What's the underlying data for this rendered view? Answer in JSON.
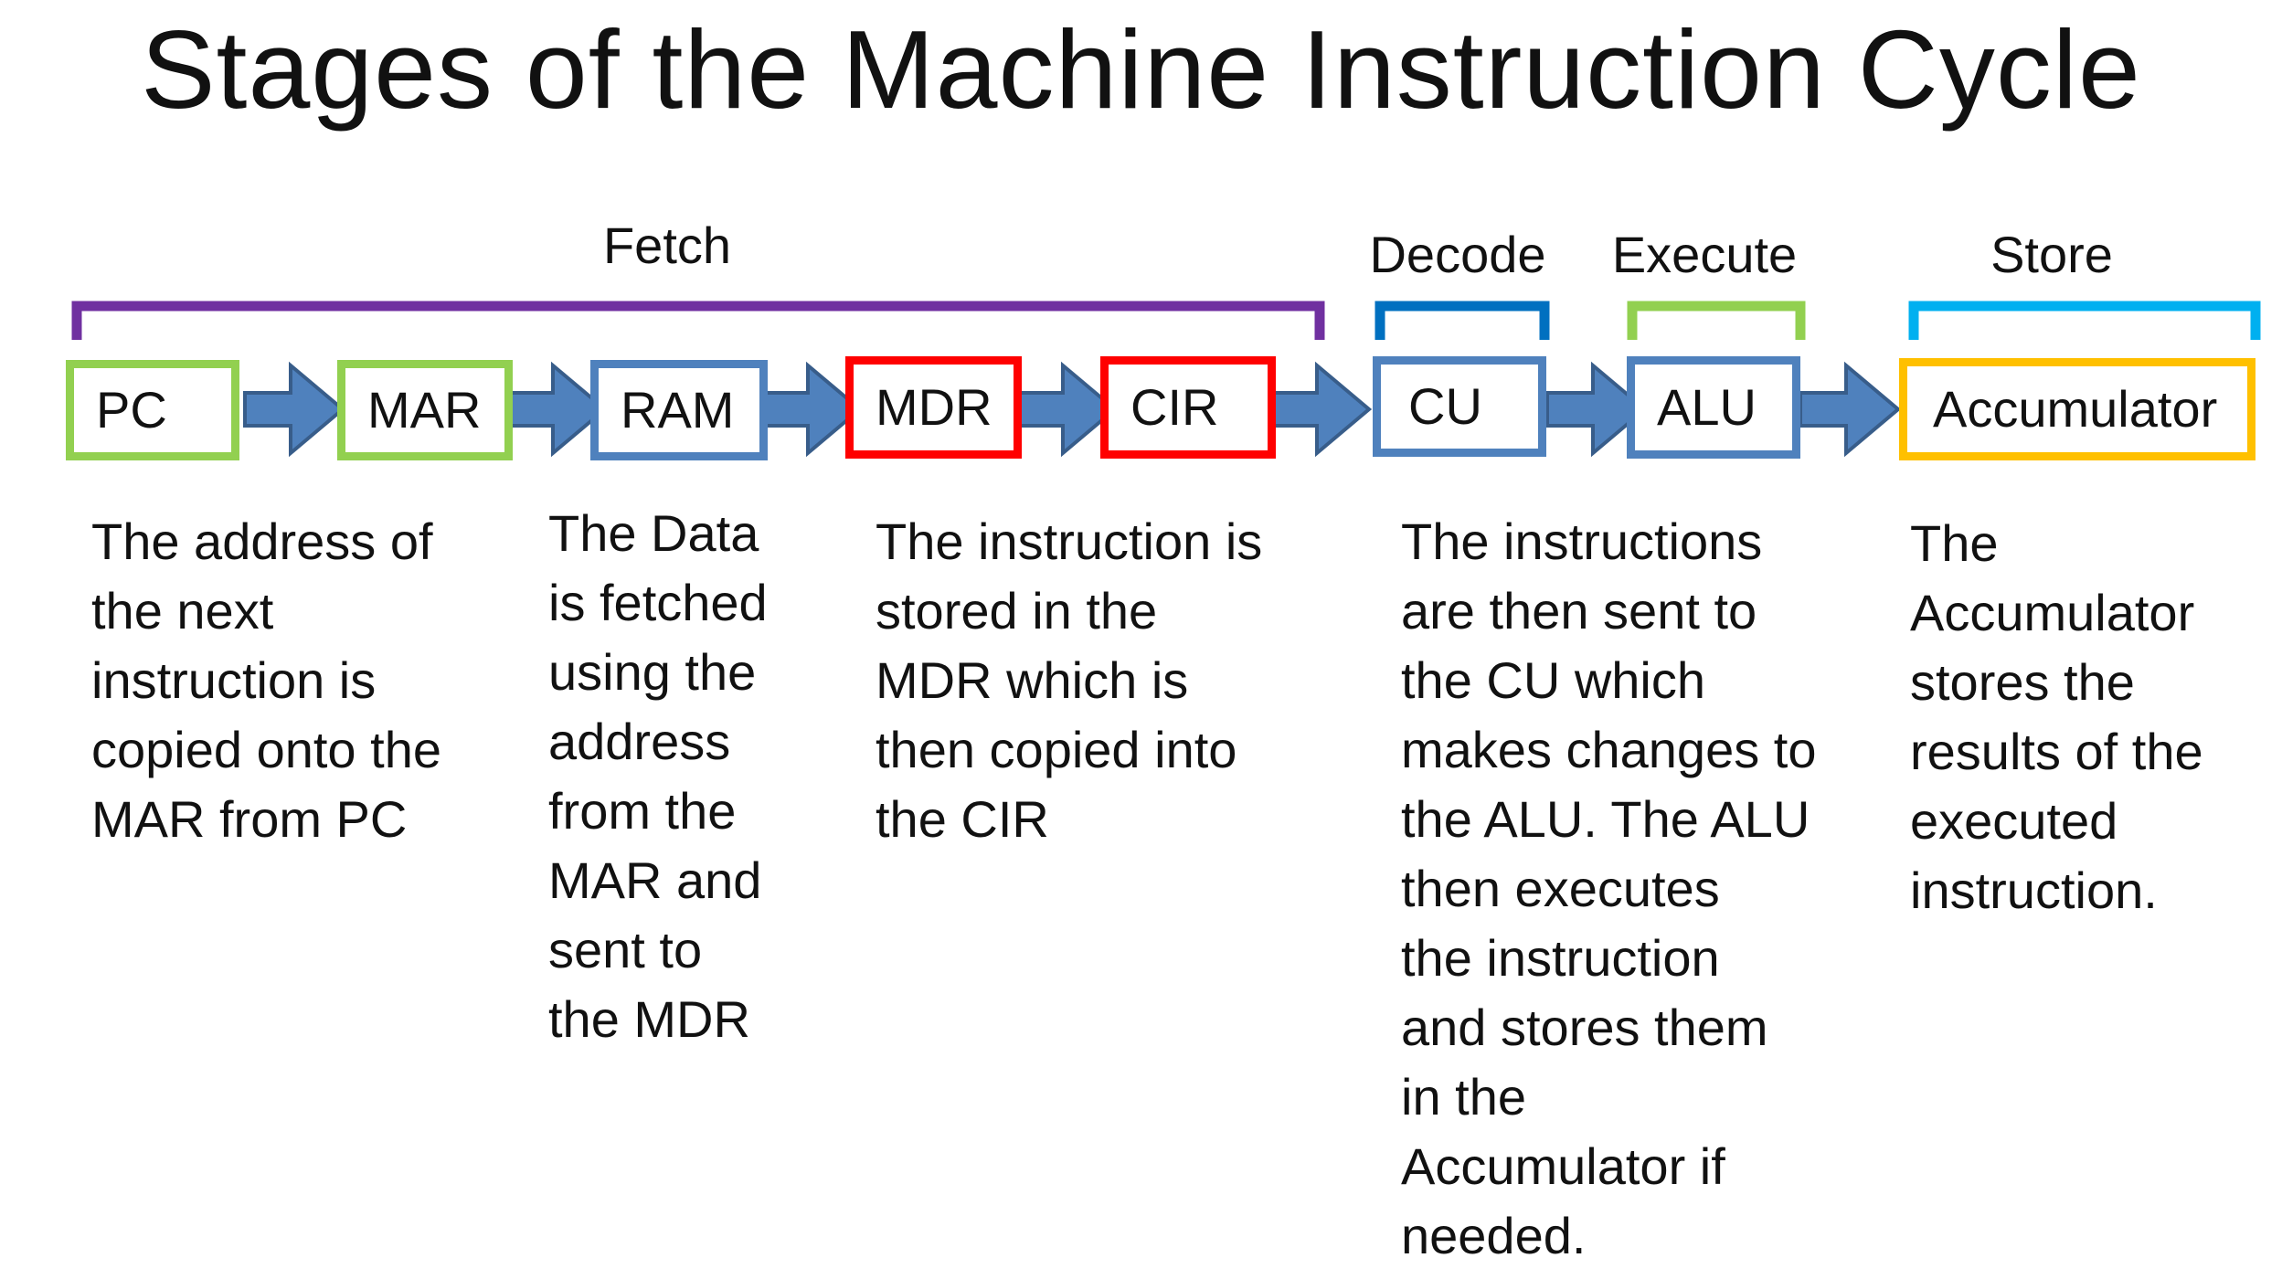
{
  "title": "Stages of the Machine Instruction Cycle",
  "stages": {
    "fetch": "Fetch",
    "decode": "Decode",
    "execute": "Execute",
    "store": "Store"
  },
  "nodes": {
    "pc": "PC",
    "mar": "MAR",
    "ram": "RAM",
    "mdr": "MDR",
    "cir": "CIR",
    "cu": "CU",
    "alu": "ALU",
    "accumulator": "Accumulator"
  },
  "descriptions": {
    "pc_mar": "The address of\nthe next\ninstruction is\ncopied onto the\nMAR from PC",
    "ram": "The Data\nis fetched\nusing the\naddress\nfrom the\nMAR and\nsent to\nthe MDR",
    "mdr_cir": "The instruction is\nstored in the\nMDR which is\nthen copied into\nthe CIR",
    "cu_alu": "The instructions\nare then sent to\nthe CU which\nmakes changes to\nthe ALU. The ALU\nthen executes\nthe instruction\nand stores them\nin the\nAccumulator if\nneeded.",
    "accumulator": "The\nAccumulator\nstores the\nresults of the\nexecuted\ninstruction."
  },
  "colors": {
    "fetch_bracket": "#7030a0",
    "decode_bracket": "#0070c0",
    "execute_bracket": "#92d050",
    "store_bracket": "#00b0f0",
    "green_border": "#92d050",
    "blue_border": "#4f81bd",
    "red_border": "#ff0000",
    "orange_border": "#ffc000",
    "arrow_fill": "#4f81bd",
    "arrow_stroke": "#385d8a"
  }
}
